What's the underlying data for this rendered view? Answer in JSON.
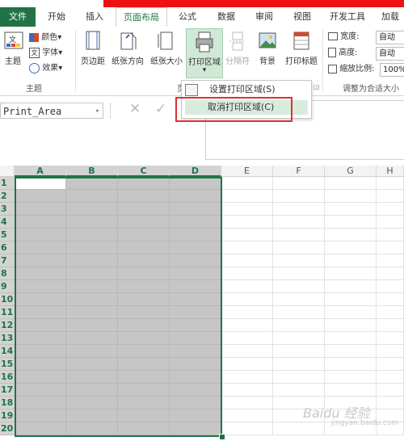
{
  "tabs": [
    {
      "label": "文件"
    },
    {
      "label": "开始"
    },
    {
      "label": "插入"
    },
    {
      "label": "页面布局"
    },
    {
      "label": "公式"
    },
    {
      "label": "数据"
    },
    {
      "label": "审阅"
    },
    {
      "label": "视图"
    },
    {
      "label": "开发工具"
    },
    {
      "label": "加载"
    }
  ],
  "ribbon": {
    "theme_group": {
      "theme_label": "主题",
      "colors_label": "颜色",
      "fonts_label": "字体",
      "effects_label": "效果",
      "group_label": "主题"
    },
    "page_setup": {
      "margins": "页边距",
      "orientation": "纸张方向",
      "size": "纸张大小",
      "print_area": "打印区域",
      "breaks": "分隔符",
      "background": "背景",
      "print_titles": "打印标题",
      "group_label": "页"
    },
    "scale": {
      "width_label": "宽度:",
      "width_value": "自动",
      "height_label": "高度:",
      "height_value": "自动",
      "scale_label": "缩放比例:",
      "scale_value": "100%",
      "group_label": "调整为合适大小"
    }
  },
  "dropdown": {
    "items": [
      {
        "label": "设置打印区域(S)"
      },
      {
        "label": "取消打印区域(C)"
      }
    ]
  },
  "namebox": {
    "value": "Print_Area"
  },
  "columns": [
    "A",
    "B",
    "C",
    "D",
    "E",
    "F",
    "G",
    "H"
  ],
  "rows": [
    "1",
    "2",
    "3",
    "4",
    "5",
    "6",
    "7",
    "8",
    "9",
    "10",
    "11",
    "12",
    "13",
    "14",
    "15",
    "16",
    "17",
    "18",
    "19",
    "20"
  ],
  "watermark": {
    "text": "Baidu 经验",
    "sub": "jingyan.baidu.com"
  },
  "colors": {
    "accent": "#217346",
    "highlight": "#e03030"
  }
}
